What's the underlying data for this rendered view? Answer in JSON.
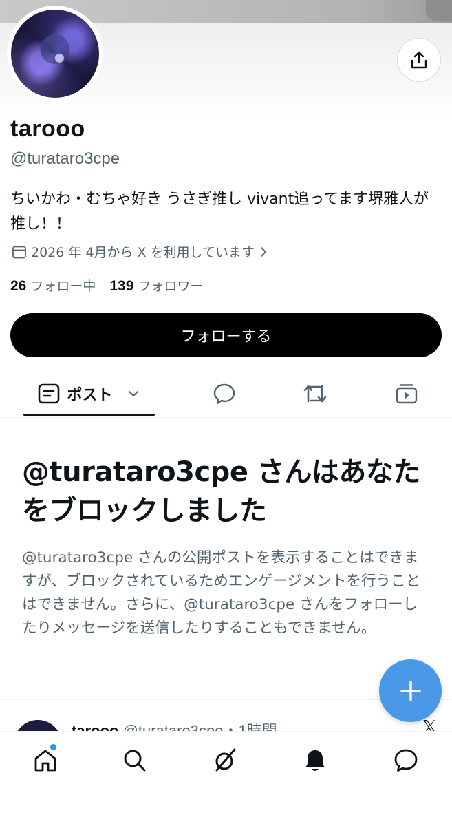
{
  "profile": {
    "display_name": "tarooo",
    "handle": "@turataro3cpe",
    "bio": "ちいかわ・むちゃ好き うさぎ推し vivant追ってます堺雅人が推し！！",
    "joined": "2026 年 4月から X を利用しています",
    "following_count": "26",
    "following_label": "フォロー中",
    "followers_count": "139",
    "followers_label": "フォロワー"
  },
  "actions": {
    "follow_label": "フォローする"
  },
  "tabs": [
    {
      "label": "ポスト",
      "icon": "posts-icon",
      "selected": true
    },
    {
      "label": "",
      "icon": "replies-icon"
    },
    {
      "label": "",
      "icon": "reposts-icon"
    },
    {
      "label": "",
      "icon": "media-icon"
    }
  ],
  "blocked": {
    "title": "@turataro3cpe さんはあなたをブロックしました",
    "body": "@turataro3cpe さんの公開ポストを表示することはできますが、ブロックされているためエンゲージメントを行うことはできません。さらに、@turataro3cpe さんをフォローしたりメッセージを送信したりすることもできません。"
  },
  "post_preview": {
    "name": "tarooo",
    "meta": "@turataro3cpe・1時間"
  },
  "nav": [
    "home-icon",
    "search-icon",
    "grok-icon",
    "notifications-icon",
    "messages-icon"
  ],
  "colors": {
    "accent": "#1d9bf0",
    "fab": "#4a99e9",
    "text": "#0f1419",
    "muted": "#536471"
  }
}
